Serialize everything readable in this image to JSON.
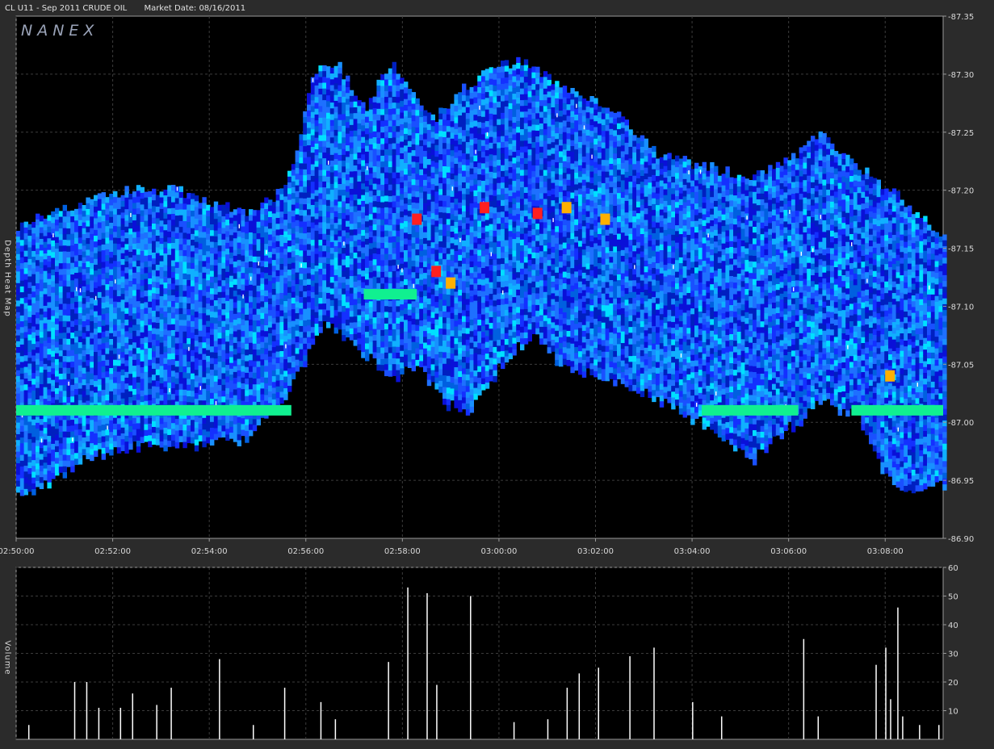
{
  "header": {
    "symbol_title": "CL U11 - Sep 2011 CRUDE OIL",
    "market_date": "Market Date: 08/16/2011"
  },
  "watermark": "NANEX",
  "panels": {
    "heatmap_label": "Depth Heat Map",
    "volume_label": "Volume"
  },
  "colors": {
    "background": "#2b2b2b",
    "plot_background": "#000000",
    "grid": "#3c3c3c",
    "axis_text": "#d8d8d8",
    "volume_bars": "#ffffff",
    "heat_low": "#1a1aff",
    "heat_mid": "#00e0ff",
    "heat_high": "#ff2020"
  },
  "chart_data": [
    {
      "type": "heatmap",
      "ylim": [
        86.9,
        87.35
      ],
      "yticks": [
        87.35,
        87.3,
        87.25,
        87.2,
        87.15,
        87.1,
        87.05,
        87.0,
        86.95,
        86.9
      ],
      "ytick_labels": [
        "-87.35",
        "-87.30",
        "-87.25",
        "-87.20",
        "-87.15",
        "-87.10",
        "-87.05",
        "-87.00",
        "-86.95",
        "-86.90"
      ],
      "xticks": [
        "02:50:00",
        "02:52:00",
        "02:54:00",
        "02:56:00",
        "02:58:00",
        "03:00:00",
        "03:02:00",
        "03:04:00",
        "03:06:00",
        "03:08:00"
      ],
      "xlim_minutes": [
        0,
        19.2
      ],
      "depth_band_upper": [
        [
          0,
          87.17
        ],
        [
          1.3,
          87.19
        ],
        [
          2.2,
          87.2
        ],
        [
          3.3,
          87.2
        ],
        [
          4.8,
          87.18
        ],
        [
          5.5,
          87.2
        ],
        [
          5.8,
          87.24
        ],
        [
          6.1,
          87.3
        ],
        [
          6.6,
          87.31
        ],
        [
          7.2,
          87.27
        ],
        [
          7.7,
          87.31
        ],
        [
          8.1,
          87.29
        ],
        [
          8.6,
          87.26
        ],
        [
          9.3,
          87.29
        ],
        [
          10.0,
          87.31
        ],
        [
          10.5,
          87.31
        ],
        [
          11.3,
          87.29
        ],
        [
          12.3,
          87.27
        ],
        [
          13.3,
          87.23
        ],
        [
          14.3,
          87.22
        ],
        [
          15.2,
          87.21
        ],
        [
          16.1,
          87.23
        ],
        [
          16.6,
          87.25
        ],
        [
          17.4,
          87.22
        ],
        [
          18.1,
          87.2
        ],
        [
          18.6,
          87.18
        ],
        [
          19.2,
          87.16
        ]
      ],
      "depth_band_lower": [
        [
          0,
          86.94
        ],
        [
          0.7,
          86.95
        ],
        [
          1.3,
          86.97
        ],
        [
          2.2,
          86.98
        ],
        [
          3.3,
          86.98
        ],
        [
          4.8,
          86.99
        ],
        [
          5.6,
          87.03
        ],
        [
          6.4,
          87.09
        ],
        [
          7.2,
          87.06
        ],
        [
          7.7,
          87.04
        ],
        [
          8.3,
          87.05
        ],
        [
          8.8,
          87.02
        ],
        [
          9.3,
          87.01
        ],
        [
          10.0,
          87.05
        ],
        [
          10.7,
          87.08
        ],
        [
          11.3,
          87.05
        ],
        [
          12.3,
          87.04
        ],
        [
          13.3,
          87.02
        ],
        [
          14.3,
          87.0
        ],
        [
          15.2,
          86.97
        ],
        [
          16.1,
          87.0
        ],
        [
          16.6,
          87.02
        ],
        [
          17.4,
          87.01
        ],
        [
          17.9,
          86.96
        ],
        [
          18.6,
          86.94
        ],
        [
          19.2,
          86.95
        ]
      ],
      "hot_spots": [
        {
          "t": 8.3,
          "price": 87.175,
          "level": "high"
        },
        {
          "t": 8.7,
          "price": 87.13,
          "level": "high"
        },
        {
          "t": 9.0,
          "price": 87.12,
          "level": "warm"
        },
        {
          "t": 9.7,
          "price": 87.185,
          "level": "high"
        },
        {
          "t": 10.8,
          "price": 87.18,
          "level": "high"
        },
        {
          "t": 11.4,
          "price": 87.185,
          "level": "warm"
        },
        {
          "t": 12.2,
          "price": 87.175,
          "level": "warm"
        },
        {
          "t": 18.1,
          "price": 87.04,
          "level": "warm"
        }
      ],
      "green_levels": [
        {
          "price": 87.01,
          "t_from": 0,
          "t_to": 5.7
        },
        {
          "price": 87.01,
          "t_from": 14.2,
          "t_to": 16.2
        },
        {
          "price": 87.01,
          "t_from": 17.3,
          "t_to": 19.2
        },
        {
          "price": 87.11,
          "t_from": 7.2,
          "t_to": 8.3
        }
      ]
    },
    {
      "type": "bar",
      "ylabel": "Volume",
      "ylim": [
        0,
        60
      ],
      "yticks": [
        10,
        20,
        30,
        40,
        50,
        60
      ],
      "bars": [
        [
          0.25,
          5
        ],
        [
          1.2,
          20
        ],
        [
          1.45,
          20
        ],
        [
          1.7,
          11
        ],
        [
          2.15,
          11
        ],
        [
          2.4,
          16
        ],
        [
          2.9,
          12
        ],
        [
          3.2,
          18
        ],
        [
          4.2,
          28
        ],
        [
          4.9,
          5
        ],
        [
          5.55,
          18
        ],
        [
          6.3,
          13
        ],
        [
          6.6,
          7
        ],
        [
          7.7,
          27
        ],
        [
          8.1,
          53
        ],
        [
          8.5,
          51
        ],
        [
          8.7,
          19
        ],
        [
          9.4,
          50
        ],
        [
          10.3,
          6
        ],
        [
          11.0,
          7
        ],
        [
          11.4,
          18
        ],
        [
          11.65,
          23
        ],
        [
          12.05,
          25
        ],
        [
          12.7,
          29
        ],
        [
          13.2,
          32
        ],
        [
          14.0,
          13
        ],
        [
          14.6,
          8
        ],
        [
          16.3,
          35
        ],
        [
          16.6,
          8
        ],
        [
          17.8,
          26
        ],
        [
          18.0,
          32
        ],
        [
          18.1,
          14
        ],
        [
          18.25,
          46
        ],
        [
          18.35,
          8
        ],
        [
          18.7,
          5
        ],
        [
          19.1,
          5
        ]
      ]
    }
  ]
}
